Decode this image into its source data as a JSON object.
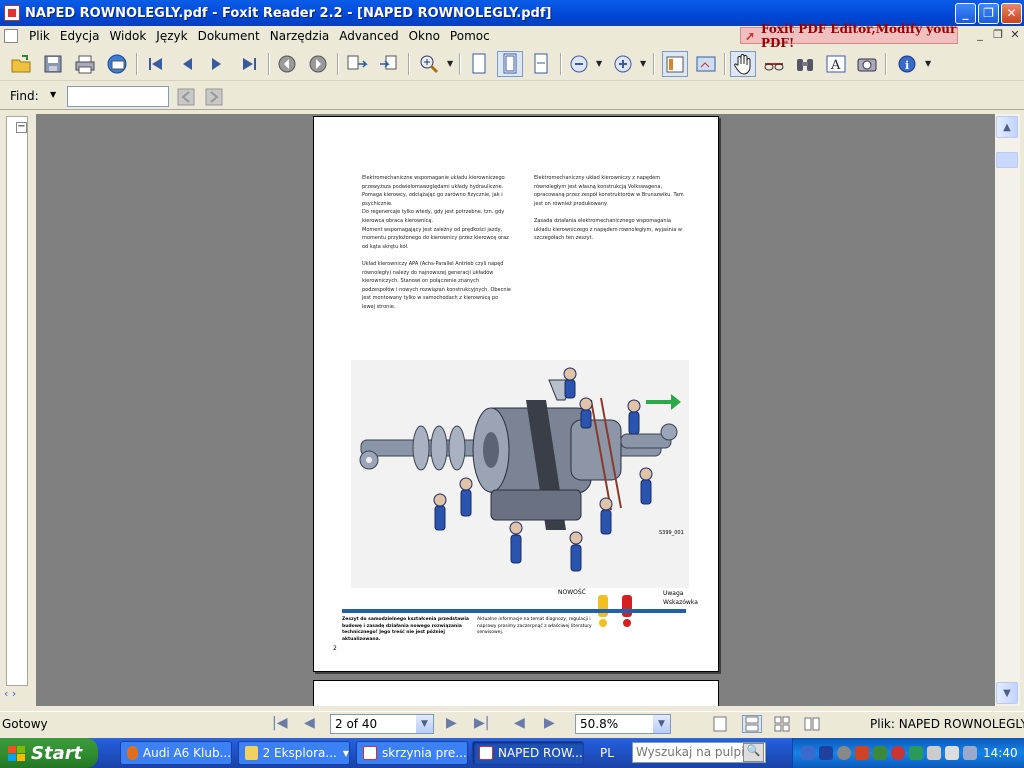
{
  "window": {
    "title": "NAPED ROWNOLEGLY.pdf - Foxit Reader 2.2 - [NAPED ROWNOLEGLY.pdf]",
    "minimize": "_",
    "maximize": "❐",
    "close": "✕"
  },
  "menu": [
    "Plik",
    "Edycja",
    "Widok",
    "Język",
    "Dokument",
    "Narzędzia",
    "Advanced",
    "Okno",
    "Pomoc"
  ],
  "ad_text": "Foxit PDF Editor,Modify your PDF!",
  "find": {
    "label": "Find:",
    "value": ""
  },
  "document": {
    "col_left": "Elektromechaniczne wspomaganie układu kierowniczego przewyższa podwielomawzględami układy hydrauliczne. Pomaga kierowcy, odciążając go zarówno fizycznie, jak i psychicznie.\nDo regenercaje tylko wtedy, gdy jest potrzebne, tzn. gdy kierowca obraca kierownicą.\nMoment wspomagający jest zależny od prędkości jazdy, momentu przyłożonego do kierownicy przez kierowcę oraz od kąta skrętu kół.\n\nUkład kierowniczy APA (Achs-Parallel Antrieb czyli napęd równoległy) należy do najnowszej generacji układów kierowniczych. Stanowi on połączenie znanych podzespołów i nowych rozwiązań konstrukcyjnych. Obecnie jest montowany tylko w samochodach z kierownicą po lewej stronie.",
    "col_right": "Elektromechaniczny układ kierowniczy z napędem równoległym jest własną konstrukcją Volkswagena, opracowaną przez zespół konstruktorów w Brunszwiku. Tam jest on również produkowany.\n\nZasada działania elektromechanicznego wspomagania układu kierowniczego z napędem równoległym, wyjaśnia w szczegółach ten zeszyt.",
    "figure_label": "S399_001",
    "nowosc": "NOWOŚĆ",
    "uwaga": "Uwaga\nWskazówka",
    "footnote_left": "Zeszyt do samodzielnego kształcenia przedstawia budowę i zasadę działania nowego rozwiązania technicznego! Jego treść nie jest później aktualizowana.",
    "footnote_right": "Aktualne informacje na temat diagnozy, regulacji i naprawy prosimy zaczerpnąć z właściwej literatury serwisowej.",
    "page_number": "2"
  },
  "status": {
    "left": "Gotowy",
    "page": "2 of 40",
    "zoom": "50.8%",
    "file": "Plik: NAPED ROWNOLEGLY.pdf ["
  },
  "taskbar": {
    "start": "Start",
    "tasks": [
      "Audi A6 Klub...",
      "2 Eksplora...",
      "skrzynia pre...",
      "NAPED ROW..."
    ],
    "lang": "PL",
    "search_placeholder": "Wyszukaj na pulpicie",
    "clock": "14:40"
  },
  "colors": {
    "accent": "#0a5ce8",
    "doc_bg": "#808080",
    "brand_blue": "#2060b0"
  }
}
